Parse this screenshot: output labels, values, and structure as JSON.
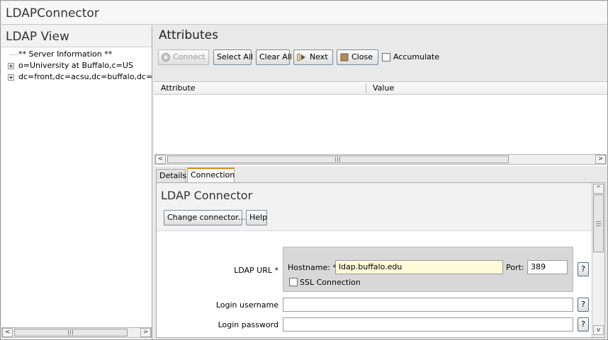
{
  "window": {
    "title": "LDAPConnector"
  },
  "left_pane": {
    "heading": "LDAP View",
    "tree": [
      {
        "label": "** Server Information **",
        "expandable": false
      },
      {
        "label": "o=University at Buffalo,c=US",
        "expandable": true
      },
      {
        "label": "dc=front,dc=acsu,dc=buffalo,dc=edu",
        "expandable": true
      }
    ]
  },
  "attributes": {
    "heading": "Attributes",
    "toolbar": {
      "connect": "Connect",
      "select_all": "Select All",
      "clear_all": "Clear All",
      "next": "Next",
      "close": "Close",
      "accumulate": "Accumulate"
    },
    "columns": [
      "Attribute",
      "Value"
    ]
  },
  "tabs": [
    {
      "label": "Details",
      "active": false
    },
    {
      "label": "Connection",
      "active": true
    }
  ],
  "connection": {
    "title": "LDAP Connector",
    "change_connector": "Change connector...",
    "help": "Help",
    "ldap_url_label": "LDAP URL *",
    "hostname_label": "Hostname: *",
    "hostname_value": "ldap.buffalo.edu",
    "port_label": "Port:",
    "port_value": "389",
    "ssl_label": "SSL Connection",
    "login_username_label": "Login username",
    "login_username_value": "",
    "login_password_label": "Login password",
    "login_password_value": "",
    "help_glyph": "?"
  },
  "scroll_arrows": {
    "left": "<",
    "right": ">",
    "up": "^",
    "down": "v"
  },
  "colors": {
    "active_tab_accent": "#d58b1e",
    "hostname_field_bg": "#fdfbd8"
  }
}
